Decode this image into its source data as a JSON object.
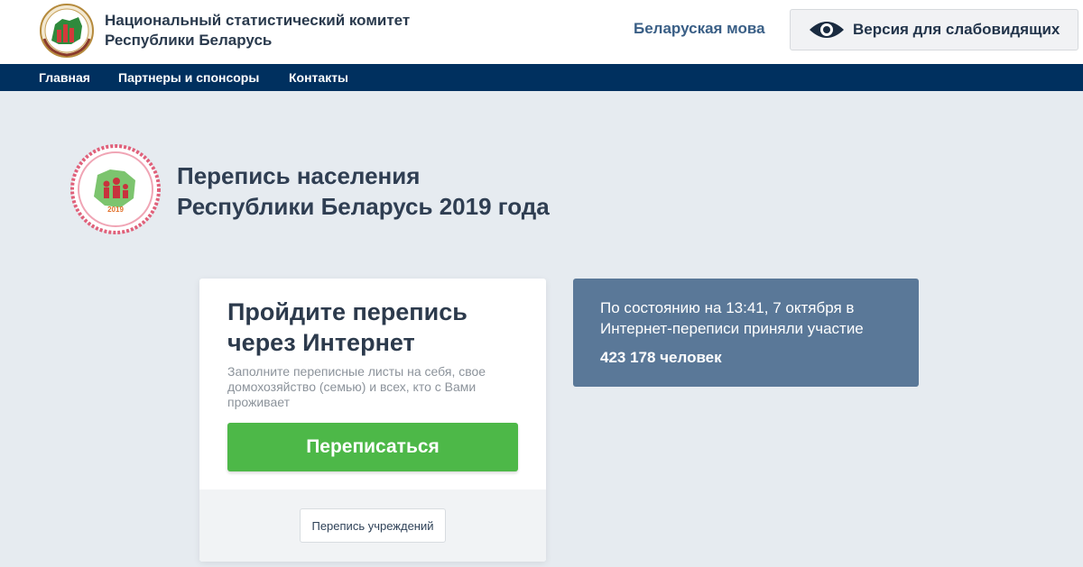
{
  "header": {
    "org_title_line1": "Национальный статистический комитет",
    "org_title_line2": "Республики Беларусь",
    "lang_link": "Беларуская мова",
    "vision_button": "Версия для слабовидящих"
  },
  "nav": {
    "items": [
      {
        "label": "Главная"
      },
      {
        "label": "Партнеры и спонсоры"
      },
      {
        "label": "Контакты"
      }
    ]
  },
  "census": {
    "title_line1": "Перепись населения",
    "title_line2": "Республики Беларусь 2019 года",
    "logo_year": "2019"
  },
  "card": {
    "title_line1": "Пройдите перепись",
    "title_line2": "через Интернет",
    "description": "Заполните переписные листы на себя, свое домохозяйство (семью) и всех, кто с Вами проживает",
    "primary_button": "Переписаться",
    "secondary_button": "Перепись учреждений"
  },
  "stats": {
    "text": "По состоянию на 13:41, 7 октября в Интернет-переписи приняли участие",
    "count": "423 178 человек"
  },
  "colors": {
    "nav_bg": "#00305f",
    "primary_green": "#4db848",
    "stats_bg": "#5a7898",
    "page_bg": "#e6ebf0"
  },
  "icons": [
    "state-emblem-icon",
    "eye-icon",
    "census-logo-icon"
  ]
}
